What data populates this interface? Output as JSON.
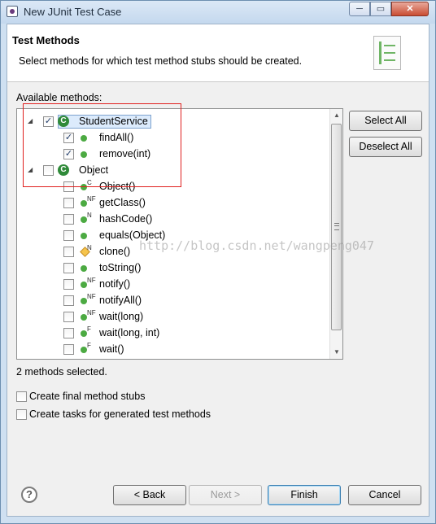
{
  "window": {
    "title": "New JUnit Test Case",
    "minimize": "─",
    "maximize": "▭",
    "close": "✕"
  },
  "header": {
    "title": "Test Methods",
    "description": "Select methods for which test method stubs should be created."
  },
  "tree": {
    "label": "Available methods:",
    "classes": [
      {
        "name": "StudentService",
        "icon": "class-icon",
        "checked": true,
        "expanded": true,
        "selected": true,
        "methods": [
          {
            "name": "findAll()",
            "modifier": "",
            "visibility": "public",
            "checked": true
          },
          {
            "name": "remove(int)",
            "modifier": "",
            "visibility": "public",
            "checked": true
          }
        ]
      },
      {
        "name": "Object",
        "icon": "class-icon",
        "checked": false,
        "expanded": true,
        "selected": false,
        "methods": [
          {
            "name": "Object()",
            "modifier": "C",
            "visibility": "public",
            "checked": false
          },
          {
            "name": "getClass()",
            "modifier": "NF",
            "visibility": "public",
            "checked": false
          },
          {
            "name": "hashCode()",
            "modifier": "N",
            "visibility": "public",
            "checked": false
          },
          {
            "name": "equals(Object)",
            "modifier": "",
            "visibility": "public",
            "checked": false
          },
          {
            "name": "clone()",
            "modifier": "N",
            "visibility": "protected",
            "checked": false
          },
          {
            "name": "toString()",
            "modifier": "",
            "visibility": "public",
            "checked": false
          },
          {
            "name": "notify()",
            "modifier": "NF",
            "visibility": "public",
            "checked": false
          },
          {
            "name": "notifyAll()",
            "modifier": "NF",
            "visibility": "public",
            "checked": false
          },
          {
            "name": "wait(long)",
            "modifier": "NF",
            "visibility": "public",
            "checked": false
          },
          {
            "name": "wait(long, int)",
            "modifier": "F",
            "visibility": "public",
            "checked": false
          },
          {
            "name": "wait()",
            "modifier": "F",
            "visibility": "public",
            "checked": false
          }
        ]
      }
    ]
  },
  "side_buttons": {
    "select_all": "Select All",
    "deselect_all": "Deselect All"
  },
  "status": "2 methods selected.",
  "options": [
    {
      "label": "Create final method stubs",
      "checked": false
    },
    {
      "label": "Create tasks for generated test methods",
      "checked": false
    }
  ],
  "footer": {
    "help": "?",
    "back": "< Back",
    "next": "Next >",
    "finish": "Finish",
    "cancel": "Cancel"
  },
  "watermark": "http://blog.csdn.net/wangpeng047",
  "colors": {
    "accent": "#3c7fb1",
    "highlight": "#e0201f",
    "method_icon": "#4caa42",
    "class_icon": "#2f8a39"
  }
}
